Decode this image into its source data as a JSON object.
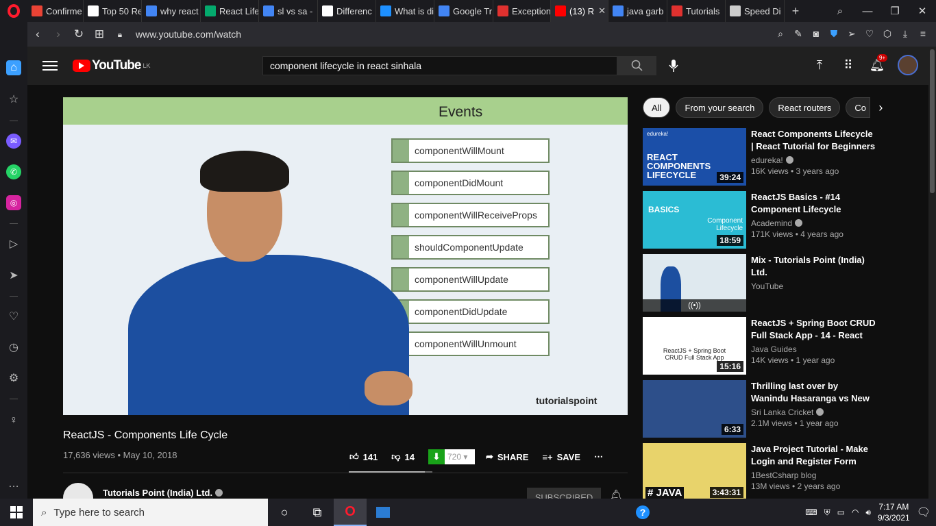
{
  "browser": {
    "tabs": [
      {
        "label": "Confirme",
        "icon": "gmail-icon",
        "color": "#ea4335"
      },
      {
        "label": "Top 50 Re",
        "icon": "page-icon",
        "color": "#ffffff"
      },
      {
        "label": "why react",
        "icon": "google-icon",
        "color": "#4285f4"
      },
      {
        "label": "React Life",
        "icon": "w3schools-icon",
        "color": "#04aa6d"
      },
      {
        "label": "sl vs sa - ",
        "icon": "google-icon",
        "color": "#4285f4"
      },
      {
        "label": "Differenc",
        "icon": "page-icon",
        "color": "#ffffff"
      },
      {
        "label": "What is di",
        "icon": "edureka-icon",
        "color": "#1e90ff"
      },
      {
        "label": "Google Tr",
        "icon": "translate-icon",
        "color": "#4285f4"
      },
      {
        "label": "Exception",
        "icon": "vivaldi-icon",
        "color": "#e0312f"
      },
      {
        "label": "(13) R",
        "icon": "youtube-icon",
        "color": "#ff0000"
      },
      {
        "label": "java garb",
        "icon": "google-icon",
        "color": "#4285f4"
      },
      {
        "label": "Tutorials",
        "icon": "vivaldi-icon",
        "color": "#e0312f"
      },
      {
        "label": "Speed Di",
        "icon": "grid-icon",
        "color": "#cccccc"
      }
    ],
    "active_tab_index": 9,
    "url": "www.youtube.com/watch"
  },
  "youtube": {
    "logo_text": "YouTube",
    "country_code": "LK",
    "search_query": "component lifecycle in react sinhala",
    "notification_count": "9+",
    "video": {
      "slide_title": "Events",
      "events": [
        "componentWillMount",
        "componentDidMount",
        "componentWillReceiveProps",
        "shouldComponentUpdate",
        "componentWillUpdate",
        "componentDidUpdate",
        "componentWillUnmount"
      ],
      "watermark": "tutorialspoint",
      "title": "ReactJS - Components Life Cycle",
      "meta": "17,636 views • May 10, 2018",
      "likes": "141",
      "dislikes": "14",
      "like_ratio": 0.91,
      "download_quality": "720",
      "share_label": "SHARE",
      "save_label": "SAVE",
      "channel": "Tutorials Point (India) Ltd.",
      "subscribe_label": "SUBSCRIBED"
    },
    "chips": [
      "All",
      "From your search",
      "React routers",
      "Co"
    ],
    "recommendations": [
      {
        "title": "React Components Lifecycle | React Tutorial for Beginners |...",
        "channel": "edureka!",
        "verified": true,
        "stats": "16K views • 3 years ago",
        "duration": "39:24",
        "thumb_color": "#1b4fa8",
        "thumb_text": "REACT COMPONENTS LIFECYCLE",
        "thumb_brand": "edureka!"
      },
      {
        "title": "ReactJS Basics - #14 Component Lifecycle",
        "channel": "Academind",
        "verified": true,
        "stats": "171K views • 4 years ago",
        "duration": "18:59",
        "thumb_color": "#2bbcd4",
        "thumb_text": "BASICS",
        "thumb_sub": "Component Lifecycle"
      },
      {
        "title": "Mix - Tutorials Point (India) Ltd.",
        "channel": "YouTube",
        "verified": false,
        "stats": "",
        "duration": "",
        "thumb_color": "#dfe9ef"
      },
      {
        "title": "ReactJS + Spring Boot CRUD Full Stack App - 14 - React A...",
        "channel": "Java Guides",
        "verified": false,
        "stats": "14K views • 1 year ago",
        "duration": "15:16",
        "thumb_color": "#ffffff",
        "thumb_text": "ReactJS + Spring Boot CRUD Full Stack App"
      },
      {
        "title": "Thrilling last over by Wanindu Hasaranga vs New Zealand -...",
        "channel": "Sri Lanka Cricket",
        "verified": true,
        "stats": "2.1M views • 1 year ago",
        "duration": "6:33",
        "thumb_color": "#2d4f8a"
      },
      {
        "title": "Java Project Tutorial - Make Login and Register Form Ste...",
        "channel": "1BestCsharp blog",
        "verified": false,
        "stats": "13M views • 2 years ago",
        "duration": "3:43:31",
        "thumb_color": "#e8d36b",
        "thumb_text": "# JAVA"
      }
    ]
  },
  "taskbar": {
    "search_placeholder": "Type here to search",
    "time": "7:17 AM",
    "date": "9/3/2021"
  }
}
